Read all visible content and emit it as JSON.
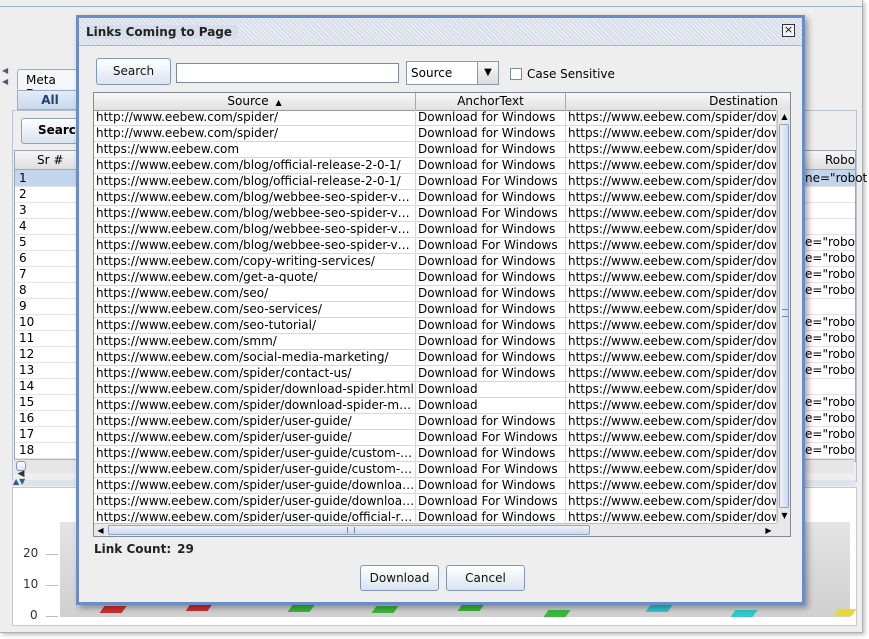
{
  "background": {
    "tab_label": "Meta Des",
    "subtab_label": "All",
    "search_label": "Search",
    "col_sr": "Sr #",
    "col_robots": "Robo",
    "rows": [
      "1",
      "2",
      "3",
      "4",
      "5",
      "6",
      "7",
      "8",
      "9",
      "10",
      "11",
      "12",
      "13",
      "14",
      "15",
      "16",
      "17",
      "18"
    ],
    "robots_cells": [
      "ne=\"robot",
      "",
      "",
      "",
      "e=\"robo",
      "e=\"robo",
      "e=\"robo",
      "e=\"robo",
      "",
      "e=\"robo",
      "e=\"robo",
      "e=\"robo",
      "e=\"robo",
      "",
      "e=\"robo",
      "e=\"robo",
      "e=\"robo",
      "e=\"robo"
    ],
    "chart_ticks": [
      "20",
      "10",
      "0"
    ],
    "colors": {
      "red": "#d03030",
      "green": "#3bb83b",
      "cyan": "#30c8d0",
      "yellow": "#e8d830"
    }
  },
  "dialog": {
    "title": "Links Coming to Page",
    "close_icon": "close-icon",
    "search_button": "Search",
    "search_value": "",
    "select_value": "Source",
    "case_sensitive_label": "Case Sensitive",
    "case_sensitive_checked": false,
    "columns": {
      "source": "Source",
      "sort_icon": "▲",
      "anchor": "AnchorText",
      "destination": "Destination"
    },
    "rows": [
      {
        "source": "http://www.eebew.com/spider/",
        "anchor": "Download for Windows",
        "dest": "https://www.eebew.com/spider/downlo"
      },
      {
        "source": "http://www.eebew.com/spider/",
        "anchor": "Download for Windows",
        "dest": "https://www.eebew.com/spider/downlo"
      },
      {
        "source": "https://www.eebew.com",
        "anchor": "Download for Windows",
        "dest": "https://www.eebew.com/spider/downlo"
      },
      {
        "source": "https://www.eebew.com/blog/official-release-2-0-1/",
        "anchor": "Download for Windows",
        "dest": "https://www.eebew.com/spider/downlo"
      },
      {
        "source": "https://www.eebew.com/blog/official-release-2-0-1/",
        "anchor": "Download For Windows",
        "dest": "https://www.eebew.com/spider/downlo"
      },
      {
        "source": "https://www.eebew.com/blog/webbee-seo-spider-versio...",
        "anchor": "Download for Windows",
        "dest": "https://www.eebew.com/spider/downlo"
      },
      {
        "source": "https://www.eebew.com/blog/webbee-seo-spider-versio...",
        "anchor": "Download For Windows",
        "dest": "https://www.eebew.com/spider/downlo"
      },
      {
        "source": "https://www.eebew.com/blog/webbee-seo-spider-versio...",
        "anchor": "Download for Windows",
        "dest": "https://www.eebew.com/spider/downlo"
      },
      {
        "source": "https://www.eebew.com/blog/webbee-seo-spider-versio...",
        "anchor": "Download For Windows",
        "dest": "https://www.eebew.com/spider/downlo"
      },
      {
        "source": "https://www.eebew.com/copy-writing-services/",
        "anchor": "Download for Windows",
        "dest": "https://www.eebew.com/spider/downlo"
      },
      {
        "source": "https://www.eebew.com/get-a-quote/",
        "anchor": "Download for Windows",
        "dest": "https://www.eebew.com/spider/downlo"
      },
      {
        "source": "https://www.eebew.com/seo/",
        "anchor": "Download for Windows",
        "dest": "https://www.eebew.com/spider/downlo"
      },
      {
        "source": "https://www.eebew.com/seo-services/",
        "anchor": "Download for Windows",
        "dest": "https://www.eebew.com/spider/downlo"
      },
      {
        "source": "https://www.eebew.com/seo-tutorial/",
        "anchor": "Download for Windows",
        "dest": "https://www.eebew.com/spider/downlo"
      },
      {
        "source": "https://www.eebew.com/smm/",
        "anchor": "Download for Windows",
        "dest": "https://www.eebew.com/spider/downlo"
      },
      {
        "source": "https://www.eebew.com/social-media-marketing/",
        "anchor": "Download for Windows",
        "dest": "https://www.eebew.com/spider/downlo"
      },
      {
        "source": "https://www.eebew.com/spider/contact-us/",
        "anchor": "Download for Windows",
        "dest": "https://www.eebew.com/spider/downlo"
      },
      {
        "source": "https://www.eebew.com/spider/download-spider.html",
        "anchor": "Download",
        "dest": "https://www.eebew.com/spider/downlo"
      },
      {
        "source": "https://www.eebew.com/spider/download-spider-mac.html",
        "anchor": "Download",
        "dest": "https://www.eebew.com/spider/downlo"
      },
      {
        "source": "https://www.eebew.com/spider/user-guide/",
        "anchor": "Download for Windows",
        "dest": "https://www.eebew.com/spider/downlo"
      },
      {
        "source": "https://www.eebew.com/spider/user-guide/",
        "anchor": "Download For Windows",
        "dest": "https://www.eebew.com/spider/downlo"
      },
      {
        "source": "https://www.eebew.com/spider/user-guide/custom-robots/",
        "anchor": "Download for Windows",
        "dest": "https://www.eebew.com/spider/downlo"
      },
      {
        "source": "https://www.eebew.com/spider/user-guide/custom-robots/",
        "anchor": "Download For Windows",
        "dest": "https://www.eebew.com/spider/downlo"
      },
      {
        "source": "https://www.eebew.com/spider/user-guide/download-opt...",
        "anchor": "Download for Windows",
        "dest": "https://www.eebew.com/spider/downlo"
      },
      {
        "source": "https://www.eebew.com/spider/user-guide/download-opt...",
        "anchor": "Download For Windows",
        "dest": "https://www.eebew.com/spider/downlo"
      },
      {
        "source": "https://www.eebew.com/spider/user-guide/official-releas...",
        "anchor": "Download for Windows",
        "dest": "https://www.eebew.com/spider/downlo"
      }
    ],
    "link_count_label": "Link Count:",
    "link_count_value": "29",
    "download_button": "Download",
    "cancel_button": "Cancel"
  }
}
